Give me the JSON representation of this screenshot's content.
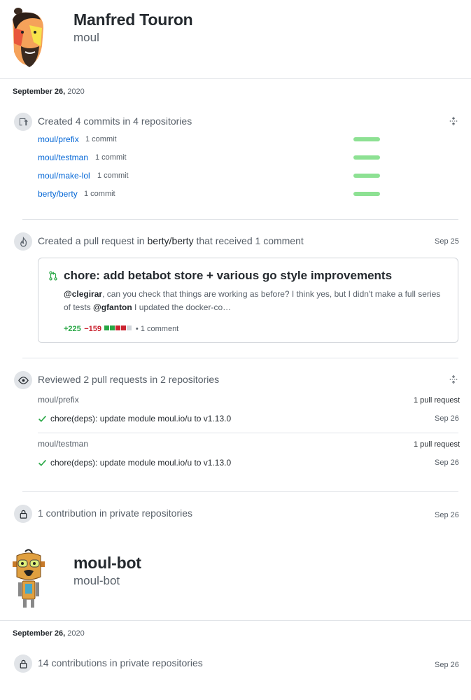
{
  "profile1": {
    "name": "Manfred Touron",
    "login": "moul",
    "date_main": "September 26,",
    "date_year": "2020",
    "commits": {
      "summary": "Created 4 commits in 4 repositories",
      "repos": [
        {
          "name": "moul/prefix",
          "count": "1 commit"
        },
        {
          "name": "moul/testman",
          "count": "1 commit"
        },
        {
          "name": "moul/make-lol",
          "count": "1 commit"
        },
        {
          "name": "berty/berty",
          "count": "1 commit"
        }
      ]
    },
    "pull_request": {
      "summary_prefix": "Created a pull request in",
      "repo": "berty/berty",
      "summary_suffix": "that received 1 comment",
      "date": "Sep 25",
      "title": "chore: add betabot store + various go style improvements",
      "body_mention1": "@clegirar",
      "body_text1": ", can you check that things are working as before? I think yes, but I didn't make a full series of tests",
      "body_mention2": "@gfanton",
      "body_text2": " I updated the docker-co…",
      "additions": "+225",
      "deletions": "−159",
      "comments": "• 1 comment"
    },
    "reviews": {
      "summary": "Reviewed 2 pull requests in 2 repositories",
      "groups": [
        {
          "repo": "moul/prefix",
          "count": "1 pull request",
          "item": "chore(deps): update module moul.io/u to v1.13.0",
          "date": "Sep 26"
        },
        {
          "repo": "moul/testman",
          "count": "1 pull request",
          "item": "chore(deps): update module moul.io/u to v1.13.0",
          "date": "Sep 26"
        }
      ]
    },
    "private": {
      "summary": "1 contribution in private repositories",
      "date": "Sep 26"
    }
  },
  "profile2": {
    "name": "moul-bot",
    "login": "moul-bot",
    "date_main": "September 26,",
    "date_year": "2020",
    "private": {
      "summary": "14 contributions in private repositories",
      "date": "Sep 26"
    }
  },
  "colors": {
    "link": "#0366d6",
    "add": "#28a745",
    "del": "#cb2431",
    "bar": "#8de193"
  },
  "icons": [
    "repo-push-icon",
    "pull-request-icon",
    "eye-icon",
    "lock-icon",
    "fold-icon",
    "check-icon"
  ]
}
